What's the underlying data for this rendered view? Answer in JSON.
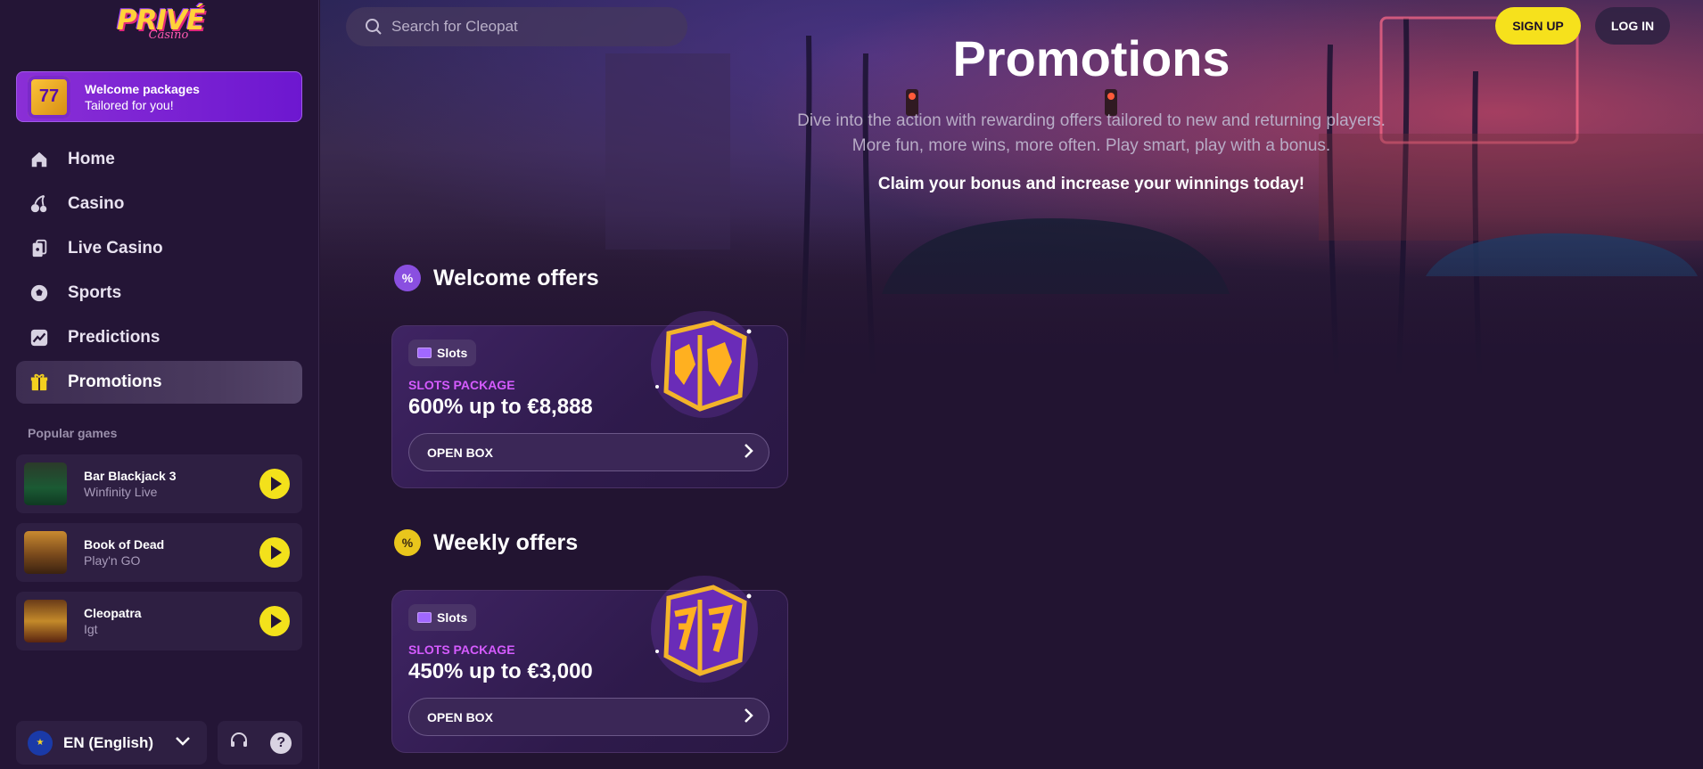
{
  "brand": {
    "logo_main": "PRIVÉ",
    "logo_sub": "Casino"
  },
  "welcome_banner": {
    "line1": "Welcome packages",
    "line2": "Tailored for you!",
    "icon_glyph": "77"
  },
  "nav": {
    "items": [
      {
        "label": "Home",
        "icon": "home-icon"
      },
      {
        "label": "Casino",
        "icon": "cherries-icon"
      },
      {
        "label": "Live Casino",
        "icon": "cards-icon"
      },
      {
        "label": "Sports",
        "icon": "soccer-ball-icon"
      },
      {
        "label": "Predictions",
        "icon": "chart-icon"
      },
      {
        "label": "Promotions",
        "icon": "gift-icon",
        "active": true
      }
    ]
  },
  "popular": {
    "label": "Popular games",
    "games": [
      {
        "title": "Bar Blackjack 3",
        "provider": "Winfinity Live"
      },
      {
        "title": "Book of Dead",
        "provider": "Play'n GO"
      },
      {
        "title": "Cleopatra",
        "provider": "Igt"
      }
    ]
  },
  "language": {
    "label": "EN (English)"
  },
  "search": {
    "placeholder": "Search for Cleopat"
  },
  "header": {
    "signup_label": "SIGN UP",
    "login_label": "LOG IN"
  },
  "page": {
    "title": "Promotions",
    "intro_line1": "Dive into the action with rewarding offers tailored to new and returning players.",
    "intro_line2": "More fun, more wins, more often. Play smart, play with a bonus.",
    "claim": "Claim your bonus and increase your winnings today!"
  },
  "sections": [
    {
      "title": "Welcome offers",
      "badge": "%",
      "badge_color": "#8a4fe0",
      "card": {
        "tag": "Slots",
        "package_label": "SLOTS PACKAGE",
        "amount": "600% up to €8,888",
        "button": "OPEN BOX"
      }
    },
    {
      "title": "Weekly offers",
      "badge": "%",
      "badge_color": "#e9c61c",
      "card": {
        "tag": "Slots",
        "package_label": "SLOTS PACKAGE",
        "amount": "450% up to €3,000",
        "button": "OPEN BOX"
      }
    }
  ],
  "colors": {
    "accent_yellow": "#f6e11c",
    "accent_purple": "#d55bff",
    "background": "#221431"
  }
}
